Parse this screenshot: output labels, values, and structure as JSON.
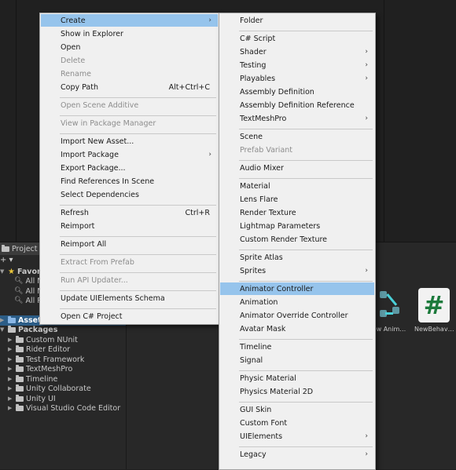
{
  "project_panel": {
    "tab_label": "Project",
    "add_label": "+ ▾",
    "favorites_label": "Favori",
    "favorite_items": [
      "All M",
      "All M",
      "All P"
    ],
    "assets_label": "Asset",
    "packages_label": "Packages",
    "packages": [
      "Custom NUnit",
      "Rider Editor",
      "Test Framework",
      "TextMeshPro",
      "Timeline",
      "Unity Collaborate",
      "Unity UI",
      "Visual Studio Code Editor"
    ]
  },
  "assets": [
    {
      "label": "ew Anim…",
      "icon": "animator-controller-icon"
    },
    {
      "label": "NewBehav…",
      "icon": "csharp-script-icon",
      "glyph": "#"
    }
  ],
  "context_menu": {
    "items": [
      {
        "label": "Create",
        "submenu": true,
        "highlighted": true
      },
      {
        "label": "Show in Explorer"
      },
      {
        "label": "Open"
      },
      {
        "label": "Delete",
        "disabled": true
      },
      {
        "label": "Rename",
        "disabled": true
      },
      {
        "label": "Copy Path",
        "shortcut": "Alt+Ctrl+C"
      },
      {
        "label": "Open Scene Additive",
        "disabled": true
      },
      {
        "label": "View in Package Manager",
        "disabled": true
      },
      {
        "label": "Import New Asset..."
      },
      {
        "label": "Import Package",
        "submenu": true
      },
      {
        "label": "Export Package..."
      },
      {
        "label": "Find References In Scene"
      },
      {
        "label": "Select Dependencies"
      },
      {
        "label": "Refresh",
        "shortcut": "Ctrl+R"
      },
      {
        "label": "Reimport"
      },
      {
        "label": "Reimport All"
      },
      {
        "label": "Extract From Prefab",
        "disabled": true
      },
      {
        "label": "Run API Updater...",
        "disabled": true
      },
      {
        "label": "Update UIElements Schema"
      },
      {
        "label": "Open C# Project"
      }
    ]
  },
  "create_submenu": {
    "items": [
      {
        "label": "Folder"
      },
      {
        "label": "C# Script"
      },
      {
        "label": "Shader",
        "submenu": true
      },
      {
        "label": "Testing",
        "submenu": true
      },
      {
        "label": "Playables",
        "submenu": true
      },
      {
        "label": "Assembly Definition"
      },
      {
        "label": "Assembly Definition Reference"
      },
      {
        "label": "TextMeshPro",
        "submenu": true
      },
      {
        "label": "Scene"
      },
      {
        "label": "Prefab Variant",
        "disabled": true
      },
      {
        "label": "Audio Mixer"
      },
      {
        "label": "Material"
      },
      {
        "label": "Lens Flare"
      },
      {
        "label": "Render Texture"
      },
      {
        "label": "Lightmap Parameters"
      },
      {
        "label": "Custom Render Texture"
      },
      {
        "label": "Sprite Atlas"
      },
      {
        "label": "Sprites",
        "submenu": true
      },
      {
        "label": "Animator Controller",
        "highlighted": true
      },
      {
        "label": "Animation"
      },
      {
        "label": "Animator Override Controller"
      },
      {
        "label": "Avatar Mask"
      },
      {
        "label": "Timeline"
      },
      {
        "label": "Signal"
      },
      {
        "label": "Physic Material"
      },
      {
        "label": "Physics Material 2D"
      },
      {
        "label": "GUI Skin"
      },
      {
        "label": "Custom Font"
      },
      {
        "label": "UIElements",
        "submenu": true
      },
      {
        "label": "Legacy",
        "submenu": true
      }
    ]
  },
  "colors": {
    "menu_background": "#f0f0f0",
    "menu_highlight": "#96c4ec",
    "disabled_text": "#8d8d8d",
    "selection_blue": "#2c5d87"
  }
}
